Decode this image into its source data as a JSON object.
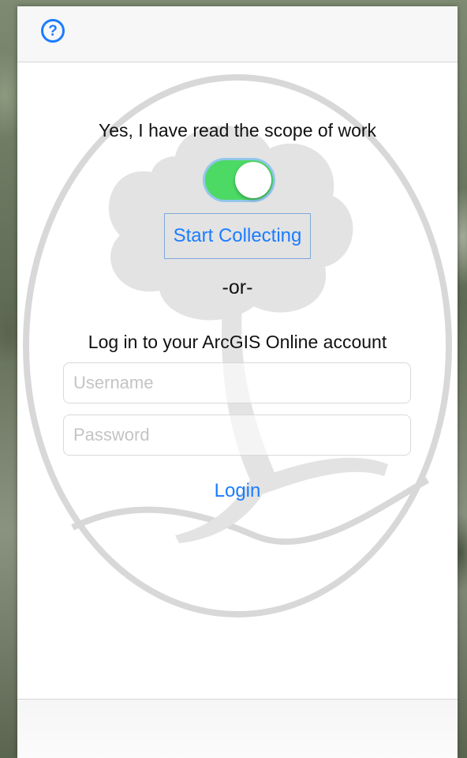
{
  "header": {
    "help_icon": "question-circle-icon",
    "help_symbol": "?"
  },
  "scope": {
    "prompt": "Yes, I have read the scope of work",
    "toggle_on": true
  },
  "start": {
    "label": "Start Collecting"
  },
  "separator": "-or-",
  "login": {
    "prompt": "Log in to your ArcGIS Online account",
    "username_placeholder": "Username",
    "username_value": "",
    "password_placeholder": "Password",
    "password_value": "",
    "button_label": "Login"
  },
  "colors": {
    "accent": "#1a7dff",
    "toggle_on": "#4cd964"
  }
}
